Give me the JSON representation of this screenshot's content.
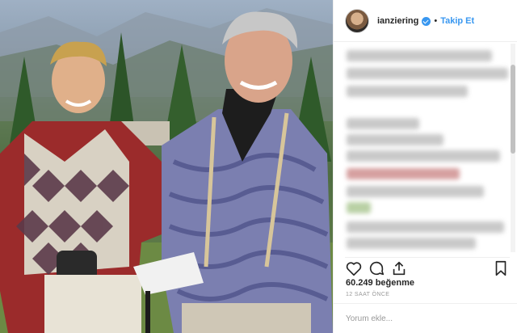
{
  "post": {
    "photo_alt": "",
    "username": "ianziering",
    "separator": "•",
    "follow_label": "Takip Et",
    "likes": "60.249 beğenme",
    "time": "12 SAAT ÖNCE",
    "comment_placeholder": "Yorum ekle..."
  },
  "icons": {
    "verified": "verified-badge-icon",
    "like": "heart-icon",
    "comment": "comment-icon",
    "share": "share-icon",
    "save": "bookmark-icon"
  },
  "colors": {
    "accent": "#3897f0",
    "text": "#262626",
    "muted": "#999999",
    "border": "#efefef"
  }
}
